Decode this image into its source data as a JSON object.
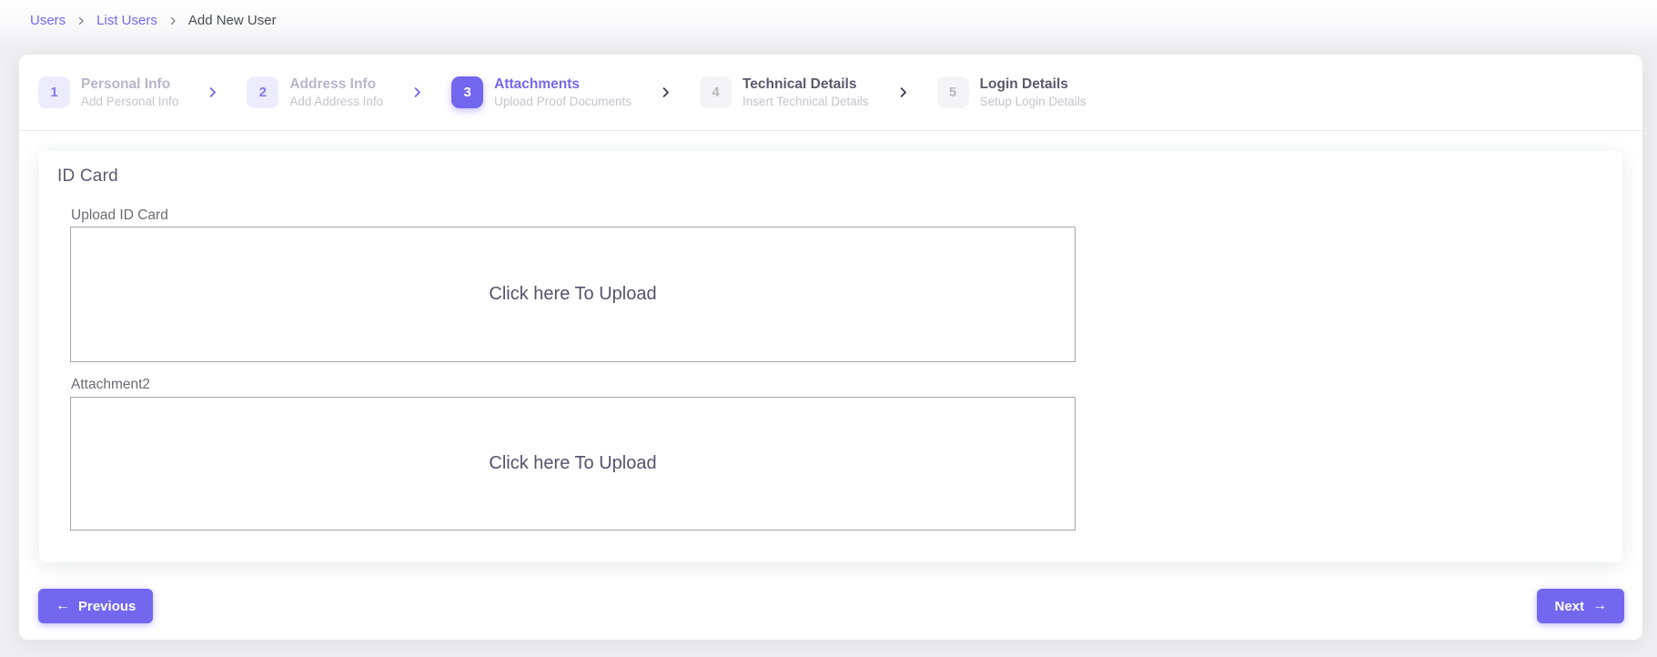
{
  "colors": {
    "primary": "#7367f0",
    "page_background": "#efeff1",
    "card_background": "#ffffff",
    "muted_text": "#b9b9c3",
    "heading_text": "#5e5873",
    "dropzone_border": "#a6a6a6"
  },
  "breadcrumb": {
    "items": [
      {
        "label": "Users",
        "type": "link"
      },
      {
        "label": "List Users",
        "type": "link"
      },
      {
        "label": "Add New User",
        "type": "current"
      }
    ]
  },
  "stepper": {
    "steps": [
      {
        "number": "1",
        "title": "Personal Info",
        "subtitle": "Add Personal Info",
        "state": "done"
      },
      {
        "number": "2",
        "title": "Address Info",
        "subtitle": "Add Address Info",
        "state": "done"
      },
      {
        "number": "3",
        "title": "Attachments",
        "subtitle": "Upload Proof Documents",
        "state": "active"
      },
      {
        "number": "4",
        "title": "Technical Details",
        "subtitle": "Insert Technical Details",
        "state": "upcoming"
      },
      {
        "number": "5",
        "title": "Login Details",
        "subtitle": "Setup Login Details",
        "state": "upcoming"
      }
    ]
  },
  "form": {
    "section_title": "ID Card",
    "fields": [
      {
        "label": "Upload ID Card",
        "dropzone_text": "Click here To Upload"
      },
      {
        "label": "Attachment2",
        "dropzone_text": "Click here To Upload"
      }
    ]
  },
  "actions": {
    "previous_label": "Previous",
    "previous_arrow": "←",
    "next_label": "Next",
    "next_arrow": "→"
  }
}
